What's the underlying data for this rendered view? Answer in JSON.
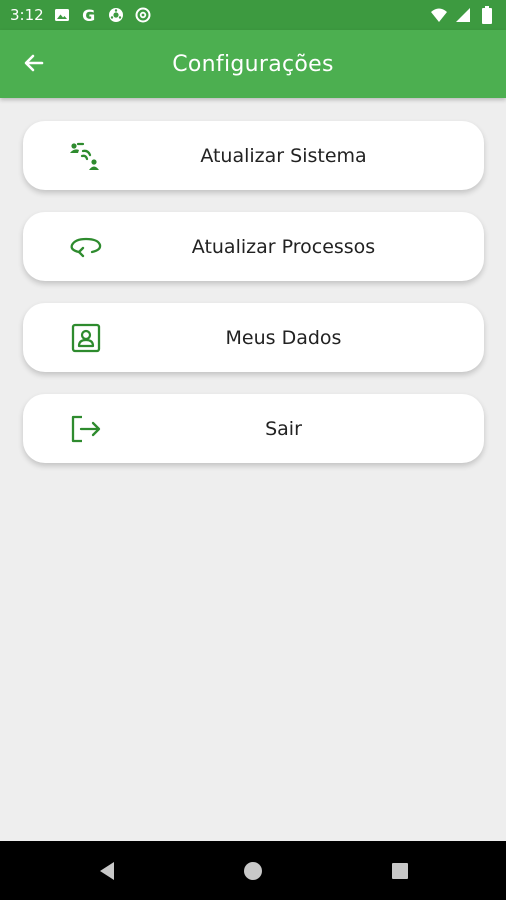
{
  "status_bar": {
    "time": "3:12",
    "g_label": "G",
    "icons": [
      "photo-icon",
      "google-icon",
      "game-icon",
      "at-icon",
      "wifi-icon",
      "signal-icon",
      "battery-icon"
    ]
  },
  "app_bar": {
    "title": "Configurações",
    "back_icon": "arrow-left-icon",
    "background": "#4caf50",
    "status_background": "#3d9a40"
  },
  "menu": {
    "items": [
      {
        "label": "Atualizar Sistema",
        "icon": "wireless-sync-icon"
      },
      {
        "label": "Atualizar Processos",
        "icon": "rotate-icon"
      },
      {
        "label": "Meus Dados",
        "icon": "contact-card-icon"
      },
      {
        "label": "Sair",
        "icon": "logout-icon"
      }
    ],
    "icon_color": "#2e8b2e"
  },
  "nav_bar": {
    "buttons": [
      "back-triangle-icon",
      "home-circle-icon",
      "recents-square-icon"
    ]
  }
}
